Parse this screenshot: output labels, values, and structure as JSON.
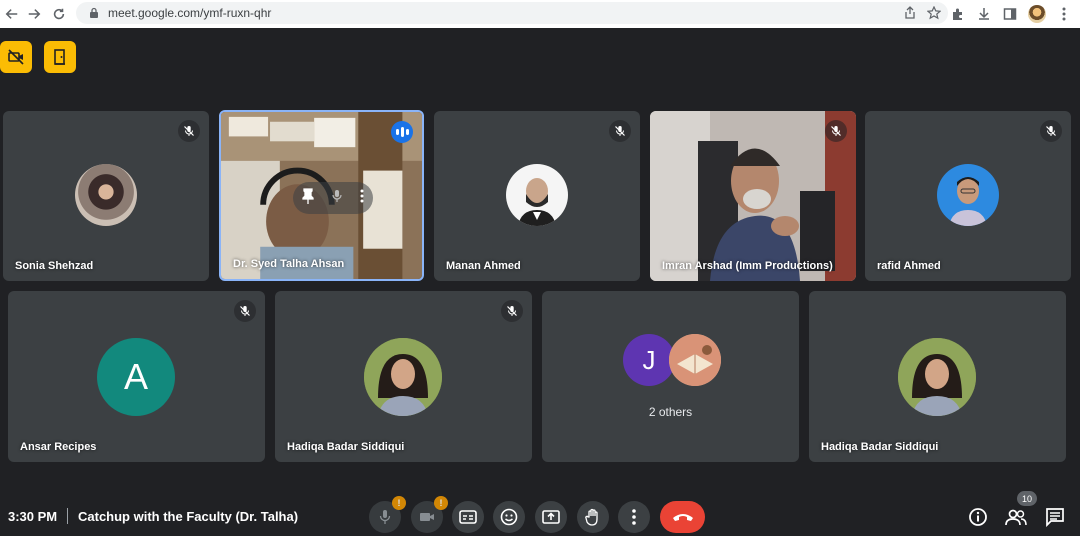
{
  "browser": {
    "url": "meet.google.com/ymf-ruxn-qhr"
  },
  "tiles_row1": [
    {
      "name": "Sonia Shehzad",
      "muted": true
    },
    {
      "name": "Dr. Syed Talha Ahsan",
      "speaking": true
    },
    {
      "name": "Manan Ahmed",
      "muted": true
    },
    {
      "name": "Imran Arshad (Imm Productions)",
      "muted": true
    },
    {
      "name": "rafid Ahmed",
      "muted": true
    }
  ],
  "tiles_row2": [
    {
      "name": "Ansar Recipes",
      "muted": true,
      "avatar_letter": "A",
      "avatar_color": "#12897d"
    },
    {
      "name": "Hadiqa Badar Siddiqui",
      "muted": true
    },
    {
      "others_label": "2 others",
      "avatar_letter": "J",
      "avatar_color": "#5e35b1"
    },
    {
      "name": "Hadiqa Badar Siddiqui"
    }
  ],
  "meeting": {
    "time": "3:30 PM",
    "title": "Catchup with the Faculty (Dr. Talha)"
  },
  "controls": {
    "mic_warning": "!",
    "camera_warning": "!",
    "participants_count": "10"
  },
  "colors": {
    "background": "#202124",
    "tile": "#3c4043",
    "accent_yellow": "#fbbc04",
    "end_call": "#ea4335",
    "speaking_blue": "#1a73e8"
  },
  "icons": [
    "back-arrow-icon",
    "forward-arrow-icon",
    "reload-icon",
    "lock-icon",
    "share-icon",
    "star-icon",
    "extensions-icon",
    "download-icon",
    "side-panel-icon",
    "more-vert-icon",
    "mic-off-icon",
    "camera-off-icon",
    "captions-icon",
    "emoji-icon",
    "present-icon",
    "raise-hand-icon",
    "more-options-icon",
    "end-call-icon",
    "info-icon",
    "people-icon",
    "chat-icon",
    "pin-icon"
  ]
}
